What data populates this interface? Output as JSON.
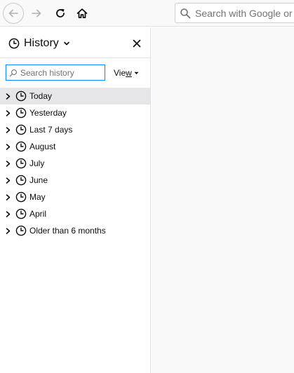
{
  "toolbar": {
    "icons": {
      "back": "back-arrow-icon",
      "forward": "forward-arrow-icon",
      "reload": "reload-icon",
      "home": "home-icon",
      "search": "search-icon"
    },
    "search_placeholder": "Search with Google or enter address"
  },
  "sidebar": {
    "title": "History",
    "filter_placeholder": "Search history",
    "view_label_prefix": "Vie",
    "view_label_accesskey": "w",
    "history_items": [
      {
        "label": "Today",
        "selected": true
      },
      {
        "label": "Yesterday",
        "selected": false
      },
      {
        "label": "Last 7 days",
        "selected": false
      },
      {
        "label": "August",
        "selected": false
      },
      {
        "label": "July",
        "selected": false
      },
      {
        "label": "June",
        "selected": false
      },
      {
        "label": "May",
        "selected": false
      },
      {
        "label": "April",
        "selected": false
      },
      {
        "label": "Older than 6 months",
        "selected": false
      }
    ]
  },
  "colors": {
    "accent": "#0a84ff",
    "selected_row": "#e6e6e8",
    "content_bg": "#f9f9fa"
  }
}
